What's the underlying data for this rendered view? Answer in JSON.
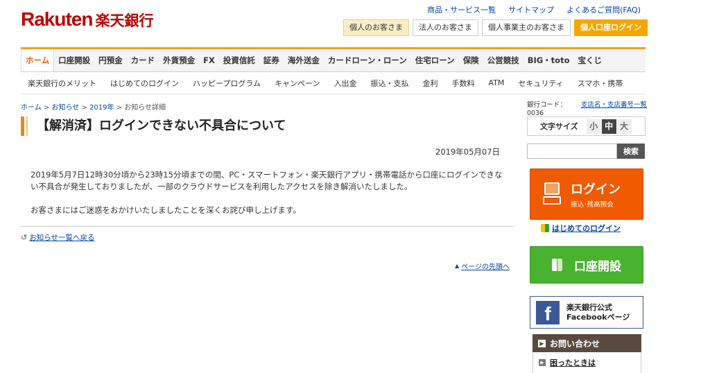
{
  "header": {
    "logo_en": "Rakuten",
    "logo_ja": "楽天銀行",
    "util_links": [
      "商品・サービス一覧",
      "サイトマップ",
      "よくあるご質問(FAQ)"
    ],
    "cust_tabs": [
      "個人のお客さま",
      "法人のお客さま",
      "個人事業主のお客さま",
      "個人口座ログイン"
    ]
  },
  "gnav": [
    "ホーム",
    "口座開設",
    "円預金",
    "カード",
    "外貨預金",
    "FX",
    "投資信託",
    "証券",
    "海外送金",
    "カードローン・ローン",
    "住宅ローン",
    "保険",
    "公営競技",
    "BIG・toto",
    "宝くじ"
  ],
  "snav": [
    "楽天銀行のメリット",
    "はじめてのログイン",
    "ハッピープログラム",
    "キャンペーン",
    "入出金",
    "振込・支払",
    "金利",
    "手数料",
    "ATM",
    "セキュリティ",
    "スマホ・携帯"
  ],
  "breadcrumb": {
    "home": "ホーム",
    "news": "お知らせ",
    "year": "2019年",
    "current": "お知らせ詳細",
    "sep": " > "
  },
  "article": {
    "title": "【解消済】ログインできない不具合について",
    "date": "2019年05月07日",
    "para1": "2019年5月7日12時30分頃から23時15分頃までの間、PC・スマートフォン・楽天銀行アプリ・携帯電話から口座にログインできない不具合が発生しておりましたが、一部のクラウドサービスを利用したアクセスを除き解消いたしました。",
    "para2": "お客さまにはご迷惑をおかけいたしましたことを深くお詫び申し上げます。",
    "back_link": "お知らせ一覧へ戻る",
    "top_link": "ページの先頭へ"
  },
  "sidebar": {
    "branch_code_label": "銀行コード：",
    "branch_code_value": "0036",
    "branch_link": "支店名・支店番号一覧",
    "font_size_label": "文字サイズ",
    "font_sizes": [
      "小",
      "中",
      "大"
    ],
    "search_button": "検索",
    "login_title": "ログイン",
    "login_sub": "振込･残高照会",
    "first_login": "はじめてのログイン",
    "open_account": "口座開設",
    "fb_line1": "楽天銀行公式",
    "fb_line2": "Facebookページ",
    "contact": "お問い合わせ",
    "trouble": "困ったときは"
  }
}
